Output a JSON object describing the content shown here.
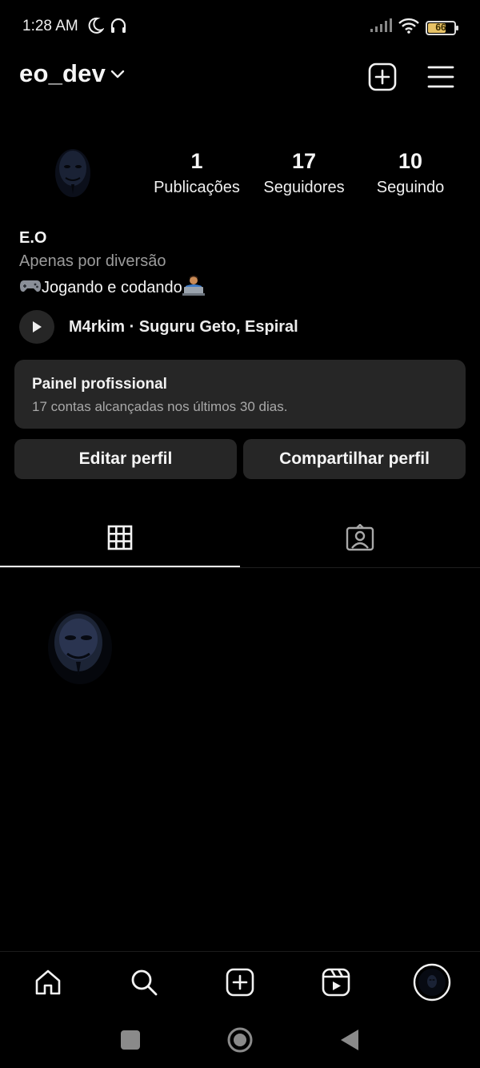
{
  "status_bar": {
    "time": "1:28 AM",
    "battery_level": "66",
    "battery_fraction": 0.66
  },
  "header": {
    "username": "eo_dev"
  },
  "profile": {
    "stats": [
      {
        "count": "1",
        "label": "Publicações"
      },
      {
        "count": "17",
        "label": "Seguidores"
      },
      {
        "count": "10",
        "label": "Seguindo"
      }
    ],
    "display_name": "E.O",
    "category": "Apenas por diversão",
    "bio_text": "Jogando e codando",
    "music": "M4rkim · Suguru Geto, Espiral"
  },
  "professional_panel": {
    "title": "Painel profissional",
    "subtitle": "17 contas alcançadas nos últimos 30 dias."
  },
  "actions": {
    "edit_label": "Editar perfil",
    "share_label": "Compartilhar perfil"
  },
  "tabs": [
    {
      "icon": "grid-icon",
      "active": true
    },
    {
      "icon": "tagged-icon",
      "active": false
    }
  ],
  "bottom_nav": [
    "home-icon",
    "search-icon",
    "create-icon",
    "reels-icon",
    "profile-avatar"
  ],
  "system_nav": [
    "recents-square",
    "home-circle",
    "back-triangle"
  ],
  "colors": {
    "background": "#000000",
    "card": "#262626",
    "muted_text": "#9b9b9b",
    "battery": "#e7c266"
  }
}
